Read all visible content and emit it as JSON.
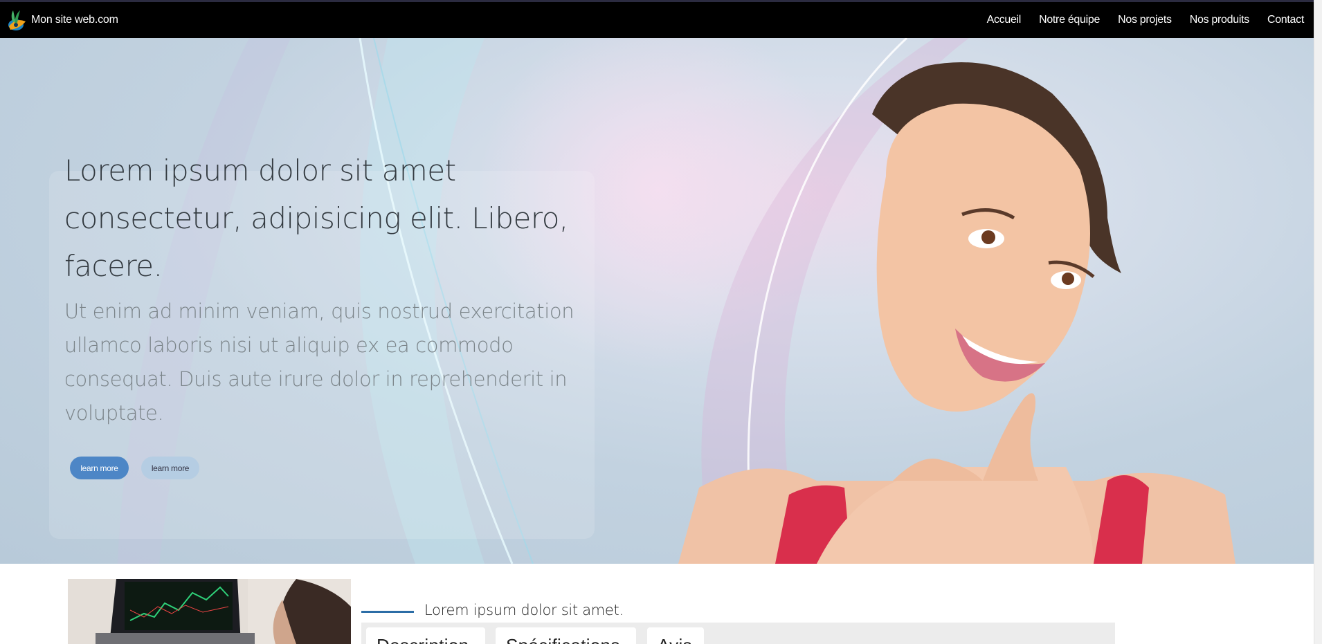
{
  "navbar": {
    "brand": "Mon site web.com",
    "links": [
      "Accueil",
      "Notre équipe",
      "Nos projets",
      "Nos produits",
      "Contact"
    ]
  },
  "hero": {
    "title": "Lorem ipsum dolor sit amet consectetur, adipisicing elit. Libero, facere.",
    "text": "Ut enim ad minim veniam, quis nostrud exercitation ullamco laboris nisi ut aliquip ex ea commodo consequat. Duis aute irure dolor in reprehenderit in voluptate.",
    "button_primary": "learn more",
    "button_secondary": "learn more"
  },
  "section": {
    "title": "Lorem ipsum dolor sit amet.",
    "tabs": [
      "Description",
      "Spécifications",
      "Avis"
    ]
  },
  "colors": {
    "navbar_bg": "#000000",
    "accent": "#4d86c6",
    "section_line": "#2c6da6"
  }
}
